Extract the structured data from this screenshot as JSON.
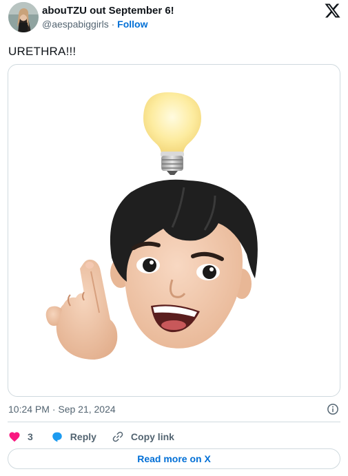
{
  "author": {
    "display_name": "abouTZU out September 6!",
    "handle": "@aespabiggirls",
    "separator": "·",
    "follow_label": "Follow"
  },
  "tweet": {
    "text": "URETHRA!!!",
    "media_icon": "memoji-lightbulb-idea-icon"
  },
  "meta": {
    "timestamp": "10:24 PM · Sep 21, 2024"
  },
  "actions": {
    "like_count": "3",
    "reply_label": "Reply",
    "copy_link_label": "Copy link"
  },
  "footer": {
    "read_more_label": "Read more on X"
  },
  "colors": {
    "link": "#006fd6",
    "like": "#f91880",
    "reply": "#1d9bf0",
    "secondary_text": "#536471",
    "border": "#cfd9de"
  }
}
